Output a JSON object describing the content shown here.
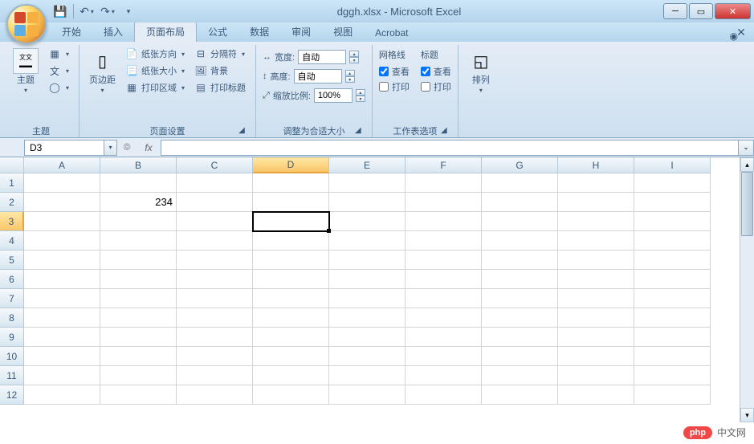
{
  "title": "dggh.xlsx - Microsoft Excel",
  "qat": {
    "save": "💾",
    "undo": "↶",
    "redo": "↷"
  },
  "tabs": [
    "开始",
    "插入",
    "页面布局",
    "公式",
    "数据",
    "审阅",
    "视图",
    "Acrobat"
  ],
  "active_tab": 2,
  "ribbon": {
    "theme": {
      "big": "主题",
      "colors": "颜色",
      "fonts": "字体",
      "effects": "效果",
      "group": "主题"
    },
    "page_setup": {
      "margins": "页边距",
      "orientation": "纸张方向",
      "size": "纸张大小",
      "print_area": "打印区域",
      "breaks": "分隔符",
      "background": "背景",
      "titles": "打印标题",
      "group": "页面设置"
    },
    "scale": {
      "width_label": "宽度:",
      "height_label": "高度:",
      "scale_label": "缩放比例:",
      "width_val": "自动",
      "height_val": "自动",
      "scale_val": "100%",
      "group": "调整为合适大小"
    },
    "sheet_options": {
      "gridlines": "网格线",
      "headings": "标题",
      "view": "查看",
      "print": "打印",
      "group": "工作表选项"
    },
    "arrange": {
      "label": "排列"
    }
  },
  "formula_bar": {
    "name_box": "D3",
    "fx": "fx"
  },
  "grid": {
    "columns": [
      "A",
      "B",
      "C",
      "D",
      "E",
      "F",
      "G",
      "H",
      "I"
    ],
    "rows": [
      "1",
      "2",
      "3",
      "4",
      "5",
      "6",
      "7",
      "8",
      "9",
      "10",
      "11",
      "12"
    ],
    "selected_cell": "D3",
    "selected_col": "D",
    "selected_row": "3",
    "data": {
      "B2": "234"
    }
  },
  "watermark": {
    "badge": "php",
    "text": "中文网"
  }
}
